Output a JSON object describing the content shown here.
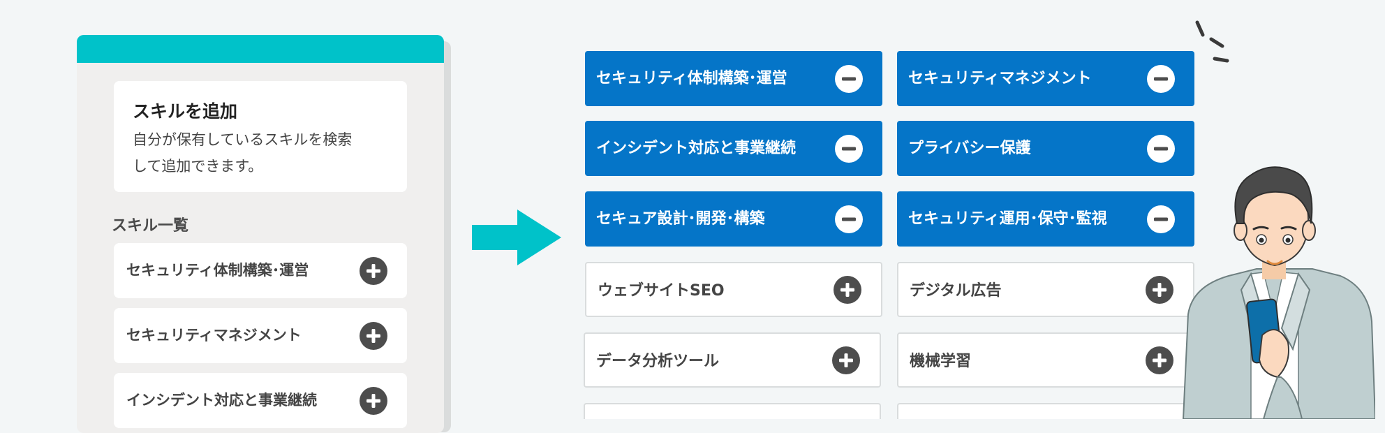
{
  "panel": {
    "card_title": "スキルを追加",
    "card_desc_line1": "自分が保有しているスキルを検索",
    "card_desc_line2": "して追加できます。",
    "list_heading": "スキル一覧",
    "items": [
      {
        "label": "セキュリティ体制構築･運営",
        "icon": "plus-circle-icon"
      },
      {
        "label": "セキュリティマネジメント",
        "icon": "plus-circle-icon"
      },
      {
        "label": "インシデント対応と事業継続",
        "icon": "plus-circle-icon"
      }
    ]
  },
  "selected_skills": [
    {
      "label": "セキュリティ体制構築･運営",
      "icon": "minus-circle-icon"
    },
    {
      "label": "セキュリティマネジメント",
      "icon": "minus-circle-icon"
    },
    {
      "label": "インシデント対応と事業継続",
      "icon": "minus-circle-icon"
    },
    {
      "label": "プライバシー保護",
      "icon": "minus-circle-icon"
    },
    {
      "label": "セキュア設計･開発･構築",
      "icon": "minus-circle-icon"
    },
    {
      "label": "セキュリティ運用･保守･監視",
      "icon": "minus-circle-icon"
    }
  ],
  "available_skills": [
    {
      "label": "ウェブサイトSEO",
      "icon": "plus-circle-icon"
    },
    {
      "label": "デジタル広告",
      "icon": "plus-circle-icon"
    },
    {
      "label": "データ分析ツール",
      "icon": "plus-circle-icon"
    },
    {
      "label": "機械学習",
      "icon": "plus-circle-icon"
    },
    {
      "label": "",
      "icon": ""
    },
    {
      "label": "",
      "icon": ""
    }
  ],
  "colors": {
    "header_teal": "#00c2c9",
    "arrow_teal": "#00c2c9",
    "selected_blue": "#0575c8",
    "icon_dark": "#4d4d4d",
    "background": "#f3f6f7"
  },
  "decoration": {
    "illustration": "person-holding-smartphone"
  }
}
